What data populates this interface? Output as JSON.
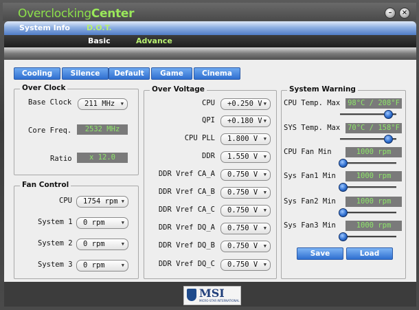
{
  "app": {
    "title_part1": "Overclocking",
    "title_part2": "Center",
    "minimize_glyph": "–",
    "close_glyph": "×"
  },
  "colors": {
    "accent_green": "#8ce04a",
    "tab_blue": "#2f6fd0",
    "readout_green": "#8ee66a"
  },
  "nav": {
    "primary_tabs": [
      {
        "label": "System Info"
      },
      {
        "label": "D.O.T."
      }
    ],
    "secondary_tabs": [
      {
        "label": "Basic"
      },
      {
        "label": "Advance"
      }
    ],
    "sub_tabs": [
      {
        "label": "Cooling"
      },
      {
        "label": "Silence"
      },
      {
        "label": "Default"
      },
      {
        "label": "Game"
      },
      {
        "label": "Cinema"
      }
    ]
  },
  "overclock": {
    "title": "Over Clock",
    "base_clock_label": "Base Clock",
    "base_clock_value": "211 MHz",
    "core_freq_label": "Core Freq.",
    "core_freq_value": "2532 MHz",
    "ratio_label": "Ratio",
    "ratio_value": "x 12.0"
  },
  "fan_control": {
    "title": "Fan Control",
    "rows": [
      {
        "label": "CPU",
        "value": "1754 rpm"
      },
      {
        "label": "System 1",
        "value": "0 rpm"
      },
      {
        "label": "System 2",
        "value": "0 rpm"
      },
      {
        "label": "System 3",
        "value": "0 rpm"
      }
    ]
  },
  "over_voltage": {
    "title": "Over Voltage",
    "rows": [
      {
        "label": "CPU",
        "value": "+0.250 V"
      },
      {
        "label": "QPI",
        "value": "+0.180 V"
      },
      {
        "label": "CPU PLL",
        "value": "1.800 V"
      },
      {
        "label": "DDR",
        "value": "1.550 V"
      },
      {
        "label": "DDR Vref CA_A",
        "value": "0.750 V"
      },
      {
        "label": "DDR Vref CA_B",
        "value": "0.750 V"
      },
      {
        "label": "DDR Vref CA_C",
        "value": "0.750 V"
      },
      {
        "label": "DDR Vref DQ_A",
        "value": "0.750 V"
      },
      {
        "label": "DDR Vref DQ_B",
        "value": "0.750 V"
      },
      {
        "label": "DDR Vref DQ_C",
        "value": "0.750 V"
      }
    ]
  },
  "system_warning": {
    "title": "System Warning",
    "rows": [
      {
        "label": "CPU Temp. Max",
        "value": "98°C / 208°F",
        "slider_fraction": 0.9
      },
      {
        "label": "SYS Temp. Max",
        "value": "70°C / 158°F",
        "slider_fraction": 0.9
      },
      {
        "label": "CPU Fan Min",
        "value": "1000 rpm",
        "slider_fraction": 0.0
      },
      {
        "label": "Sys Fan1 Min",
        "value": "1000 rpm",
        "slider_fraction": 0.0
      },
      {
        "label": "Sys Fan2 Min",
        "value": "1000 rpm",
        "slider_fraction": 0.0
      },
      {
        "label": "Sys Fan3 Min",
        "value": "1000 rpm",
        "slider_fraction": 0.0
      }
    ],
    "save_label": "Save",
    "load_label": "Load"
  },
  "footer": {
    "logo_text": "MSI",
    "logo_subtext": "MICRO-STAR INTERNATIONAL"
  }
}
